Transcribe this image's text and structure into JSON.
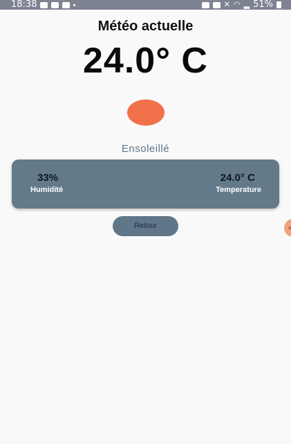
{
  "status_bar": {
    "time": "18:38",
    "battery": "51%",
    "left_icons": [
      "video-camera-icon",
      "discord-icon",
      "image-icon",
      "dot-icon"
    ],
    "right_icons": [
      "nfc-icon",
      "alarm-icon",
      "mute-icon",
      "wifi-icon",
      "signal-icon",
      "battery-icon"
    ]
  },
  "page": {
    "title": "Météo actuelle",
    "temperature": "24.0° C",
    "condition": "Ensoleillé",
    "weather_icon": "sun-icon",
    "sun_color": "#f1714a"
  },
  "card": {
    "humidity_value": "33%",
    "humidity_label": "Humidité",
    "temperature_value": "24.0° C",
    "temperature_label": "Temperature",
    "background": "#627a8a"
  },
  "back_button": {
    "label": "Retour"
  },
  "edge_panel": {
    "icon": "edge-panel-handle-icon"
  }
}
